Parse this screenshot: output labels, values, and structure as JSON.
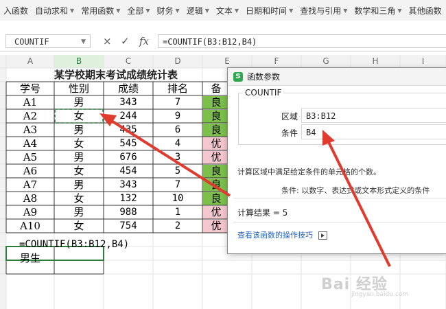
{
  "ribbon": {
    "items": [
      {
        "label": "入函数",
        "caret": false
      },
      {
        "label": "自动求和",
        "caret": true
      },
      {
        "label": "常用函数",
        "caret": true
      },
      {
        "label": "全部",
        "caret": true
      },
      {
        "label": "财务",
        "caret": true
      },
      {
        "label": "逻辑",
        "caret": true
      },
      {
        "label": "文本",
        "caret": true
      },
      {
        "label": "日期和时间",
        "caret": true
      },
      {
        "label": "查找与引用",
        "caret": true
      },
      {
        "label": "数学和三角",
        "caret": true
      },
      {
        "label": "其他函数",
        "caret": false
      }
    ]
  },
  "formula_bar": {
    "name_box": "COUNTIF",
    "cancel_icon": "×",
    "confirm_icon": "✓",
    "fx_label": "fx",
    "formula": "=COUNTIF(B3:B12,B4)"
  },
  "sheet": {
    "columns": [
      "A",
      "B",
      "C",
      "D",
      "E",
      "F",
      "G",
      "H",
      "I"
    ],
    "title": "某学校期末考试成绩统计表",
    "headers": [
      "学号",
      "性别",
      "成绩",
      "排名",
      "备"
    ],
    "rows": [
      {
        "id": "A1",
        "gender": "男",
        "score": "343",
        "rank": "7",
        "remark": "良",
        "remark_color": "#7cbf4b"
      },
      {
        "id": "A2",
        "gender": "女",
        "score": "244",
        "rank": "9",
        "remark": "良",
        "remark_color": "#7cbf4b"
      },
      {
        "id": "A3",
        "gender": "男",
        "score": "435",
        "rank": "6",
        "remark": "良",
        "remark_color": "#7cbf4b"
      },
      {
        "id": "A4",
        "gender": "女",
        "score": "545",
        "rank": "4",
        "remark": "优",
        "remark_color": "#f4c7cf"
      },
      {
        "id": "A5",
        "gender": "男",
        "score": "676",
        "rank": "3",
        "remark": "优",
        "remark_color": "#f4c7cf"
      },
      {
        "id": "A6",
        "gender": "女",
        "score": "454",
        "rank": "5",
        "remark": "良",
        "remark_color": "#7cbf4b"
      },
      {
        "id": "A7",
        "gender": "男",
        "score": "343",
        "rank": "7",
        "remark": "良",
        "remark_color": "#7cbf4b"
      },
      {
        "id": "A8",
        "gender": "女",
        "score": "132",
        "rank": "10",
        "remark": "良",
        "remark_color": "#7cbf4b"
      },
      {
        "id": "A9",
        "gender": "男",
        "score": "988",
        "rank": "1",
        "remark": "优",
        "remark_color": "#f4c7cf"
      },
      {
        "id": "A10",
        "gender": "女",
        "score": "754",
        "rank": "2",
        "remark": "优",
        "remark_color": "#f4c7cf"
      }
    ],
    "formula_cell": "=COUNTIF(B3:B12,B4)",
    "label_cell": "男生"
  },
  "dialog": {
    "title": "函数参数",
    "logo_letter": "S",
    "function_name": "COUNTIF",
    "range_label": "区域",
    "range_value": "B3:B12",
    "criteria_label": "条件",
    "criteria_value": "B4",
    "description": "计算区域中满足给定条件的单元格的个数。",
    "criteria_desc": "条件:  以数字、表达式或文本形式定义的条件",
    "result_label": "计算结果 = 5",
    "help_link": "查看该函数的操作技巧"
  },
  "watermark": {
    "text": "Bai 经验",
    "sub": "jingyan.baidu.com"
  },
  "colors": {
    "accent_green": "#2b7d3b",
    "arrow_red": "#e03b2f",
    "link_blue": "#1f5fbf"
  }
}
